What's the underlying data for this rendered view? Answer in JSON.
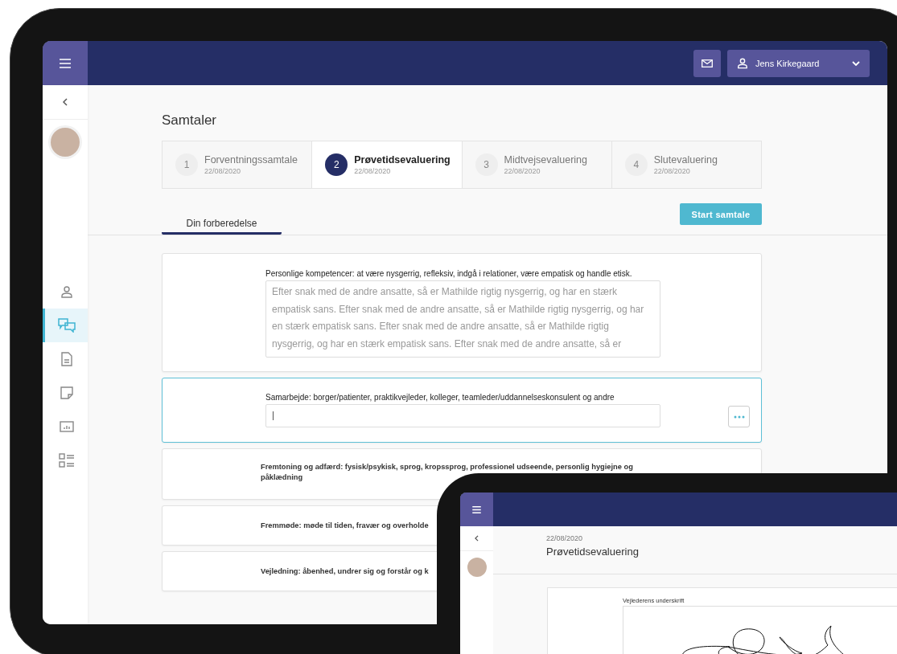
{
  "app_bar": {
    "user_name": "Jens Kirkegaard"
  },
  "sidebar": {
    "items": [
      {
        "kind": "person",
        "selected": false
      },
      {
        "kind": "chat",
        "selected": true
      },
      {
        "kind": "document",
        "selected": false
      },
      {
        "kind": "note",
        "selected": false
      },
      {
        "kind": "chart",
        "selected": false
      },
      {
        "kind": "checklist",
        "selected": false
      }
    ]
  },
  "page": {
    "title": "Samtaler",
    "steps": [
      {
        "number": "1",
        "label": "Forventningssamtale",
        "date": "22/08/2020",
        "selected": false
      },
      {
        "number": "2",
        "label": "Prøvetidsevaluering",
        "date": "22/08/2020",
        "selected": true
      },
      {
        "number": "3",
        "label": "Midtvejsevaluering",
        "date": "22/08/2020",
        "selected": false
      },
      {
        "number": "4",
        "label": "Slutevaluering",
        "date": "22/08/2020",
        "selected": false
      }
    ],
    "tabs": [
      {
        "label": "Din forberedelse",
        "selected": true
      }
    ],
    "start_button": "Start samtale",
    "questions": [
      {
        "kind": "textarea",
        "label": "Personlige kompetencer: at være nysgerrig, refleksiv, indgå i relationer, være empatisk og handle etisk.",
        "value": "Efter snak med de andre ansatte, så er Mathilde rigtig nysgerrig, og har en stærk empatisk sans. Efter snak med de andre ansatte, så er Mathilde rigtig nysgerrig, og har en stærk empatisk sans. Efter snak med de andre ansatte, så er Mathilde rigtig nysgerrig, og har en stærk empatisk sans. Efter snak med de andre ansatte, så er",
        "focused": false
      },
      {
        "kind": "input",
        "label": "Samarbejde:  borger/patienter, praktikvejleder, kolleger, teamleder/uddannelseskonsulent og andre",
        "focused": true
      },
      {
        "kind": "heading",
        "label": "Fremtoning og adfærd: fysisk/psykisk, sprog, kropssprog, professionel udseende, personlig hygiejne og påklædning"
      },
      {
        "kind": "heading",
        "label": "Fremmøde: møde til tiden, fravær og overholde"
      },
      {
        "kind": "heading",
        "label": "Vejledning: åbenhed, undrer sig og forstår og k"
      }
    ]
  },
  "preview": {
    "date": "22/08/2020",
    "title": "Prøvetidsevaluering",
    "signature_label": "Vejlederens underskrift"
  }
}
